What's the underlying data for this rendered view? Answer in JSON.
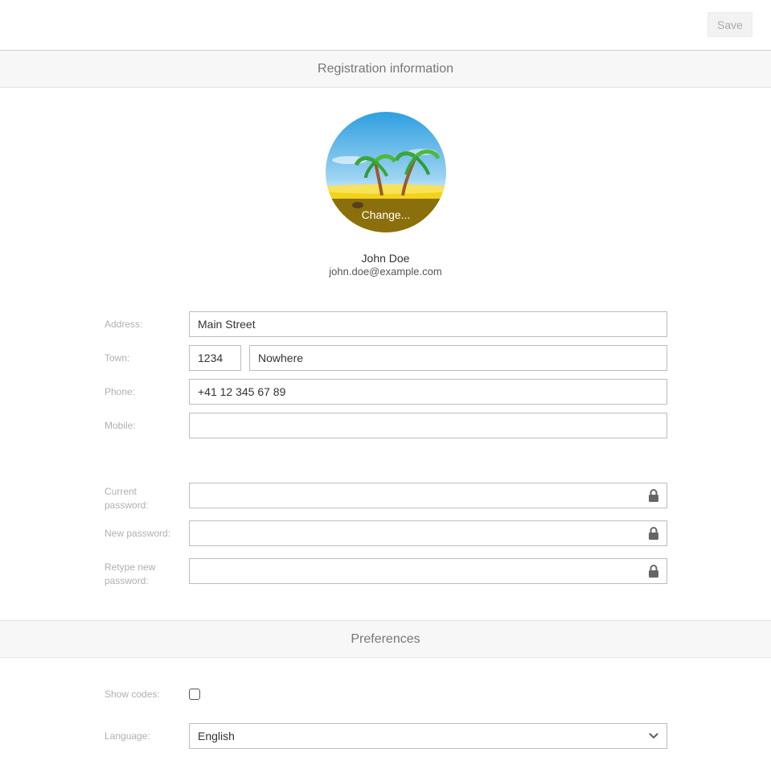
{
  "toolbar": {
    "save_label": "Save"
  },
  "sections": {
    "registration_title": "Registration information",
    "preferences_title": "Preferences"
  },
  "avatar": {
    "change_label": "Change..."
  },
  "user": {
    "name": "John Doe",
    "email": "john.doe@example.com"
  },
  "form": {
    "address_label": "Address:",
    "address_value": "Main Street",
    "town_label": "Town:",
    "zip_value": "1234",
    "town_value": "Nowhere",
    "phone_label": "Phone:",
    "phone_value": "+41 12 345 67 89",
    "mobile_label": "Mobile:",
    "mobile_value": "",
    "current_password_label": "Current password:",
    "new_password_label": "New password:",
    "retype_password_label": "Retype new password:"
  },
  "preferences": {
    "show_codes_label": "Show codes:",
    "show_codes_checked": false,
    "language_label": "Language:",
    "language_value": "English"
  },
  "icons": {
    "lock": "lock-icon",
    "chevron": "chevron-down-icon"
  }
}
